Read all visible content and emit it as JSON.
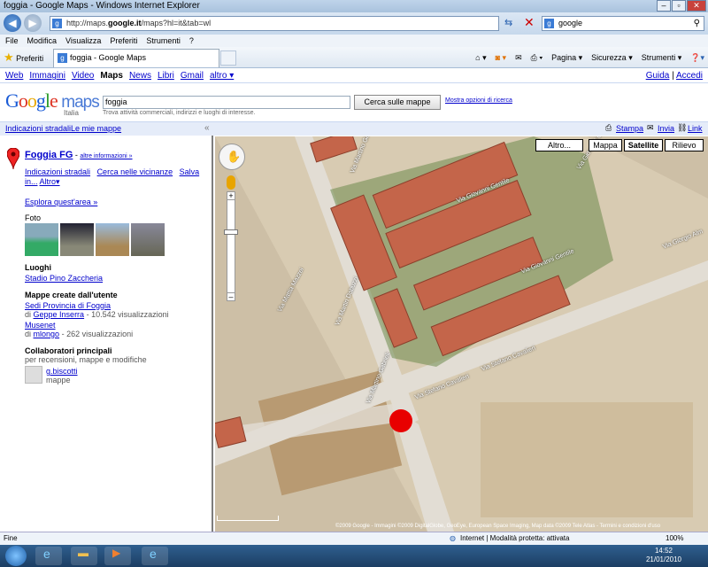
{
  "window": {
    "title": "foggia - Google Maps - Windows Internet Explorer"
  },
  "address": {
    "prefix": "http://maps.",
    "domain": "google.it",
    "path": "/maps?hl=it&tab=wl"
  },
  "search_engine": {
    "value": "google"
  },
  "menu": [
    "File",
    "Modifica",
    "Visualizza",
    "Preferiti",
    "Strumenti",
    "?"
  ],
  "favorites": {
    "label": "Preferiti",
    "tab_label": "foggia - Google Maps"
  },
  "commands": [
    "Pagina ▾",
    "Sicurezza ▾",
    "Strumenti ▾"
  ],
  "gbar": {
    "items": [
      "Web",
      "Immagini",
      "Video",
      "Maps",
      "News",
      "Libri",
      "Gmail",
      "altro ▾"
    ],
    "active": "Maps",
    "right_guide": "Guida",
    "right_access": "Accedi"
  },
  "search": {
    "logo": "Google maps",
    "logo_sub": "Italia",
    "value": "foggia",
    "hint": "Trova attività commerciali, indirizzi e luoghi di interesse.",
    "button": "Cerca sulle mappe",
    "options": "Mostra opzioni di ricerca"
  },
  "strip": {
    "directions": "Indicazioni stradali",
    "my_maps": "Le mie mappe",
    "print": "Stampa",
    "send": "Invia",
    "link": "Link"
  },
  "panel": {
    "place": "Foggia FG",
    "more_info": "altre informazioni »",
    "actions": [
      "Indicazioni stradali",
      "Cerca nelle vicinanze",
      "Salva in...",
      "Altro▾"
    ],
    "explore": "Esplora quest'area »",
    "photos": "Foto",
    "places_heading": "Luoghi",
    "place_link": "Stadio Pino Zaccheria",
    "user_maps_heading": "Mappe create dall'utente",
    "user_maps": [
      {
        "title": "Sedi Provincia di Foggia",
        "by": "di",
        "author": "Geppe Inserra",
        "views": "- 10.542 visualizzazioni"
      },
      {
        "title": "Musenet",
        "by": "di",
        "author": "mlongo",
        "views": "- 262 visualizzazioni"
      }
    ],
    "collab_heading": "Collaboratori principali",
    "collab_sub": "per recensioni, mappe e modifiche",
    "collab_user": "g.biscotti",
    "collab_user_sub": "mappe"
  },
  "map": {
    "types": [
      "Altro...",
      "Mappa",
      "Satellite",
      "Rilievo"
    ],
    "active_type": "Satellite",
    "streets": [
      "Via Mattia Mazzei",
      "Via Giovanni Gentile",
      "Via Giovanni Gentile",
      "Via Giovanni Gentile",
      "Via Giorgio Alm",
      "Via Martin Dabuzzi",
      "Via Martino Gabrieli",
      "Via Stefano Cavalieri",
      "Via Stefano Cavalieri",
      "Via Martino Gabrieli"
    ],
    "copyright": "©2009 Google - Immagini ©2009 DigitalGlobe, GeoEye, European Space Imaging, Map data ©2009 Tele Atlas - Termini e condizioni d'uso"
  },
  "status": {
    "left": "Fine",
    "zone": "Internet | Modalità protetta: attivata",
    "zoom": "100%"
  },
  "clock": {
    "time": "14:52",
    "date": "21/01/2010"
  },
  "colors": {
    "marker": "#e80000",
    "link": "#0000cc"
  }
}
